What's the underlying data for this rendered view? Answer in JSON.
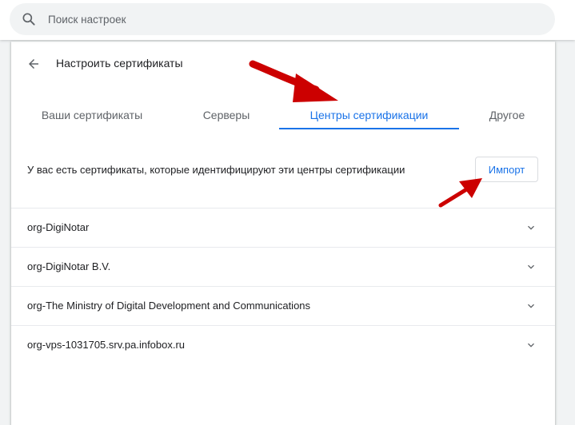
{
  "search": {
    "placeholder": "Поиск настроек",
    "value": ""
  },
  "header": {
    "title": "Настроить сертификаты"
  },
  "tabs": [
    {
      "label": "Ваши сертификаты",
      "active": false
    },
    {
      "label": "Серверы",
      "active": false
    },
    {
      "label": "Центры сертификации",
      "active": true
    },
    {
      "label": "Другое",
      "active": false
    }
  ],
  "description": "У вас есть сертификаты, которые идентифицируют эти центры сертификации",
  "import_label": "Импорт",
  "certificates": [
    {
      "label": "org-DigiNotar"
    },
    {
      "label": "org-DigiNotar B.V."
    },
    {
      "label": "org-The Ministry of Digital Development and Communications"
    },
    {
      "label": "org-vps-1031705.srv.pa.infobox.ru"
    }
  ],
  "colors": {
    "accent": "#1a73e8",
    "annotation_arrow": "#cc0000",
    "text": "#202124",
    "muted": "#5f6368"
  }
}
